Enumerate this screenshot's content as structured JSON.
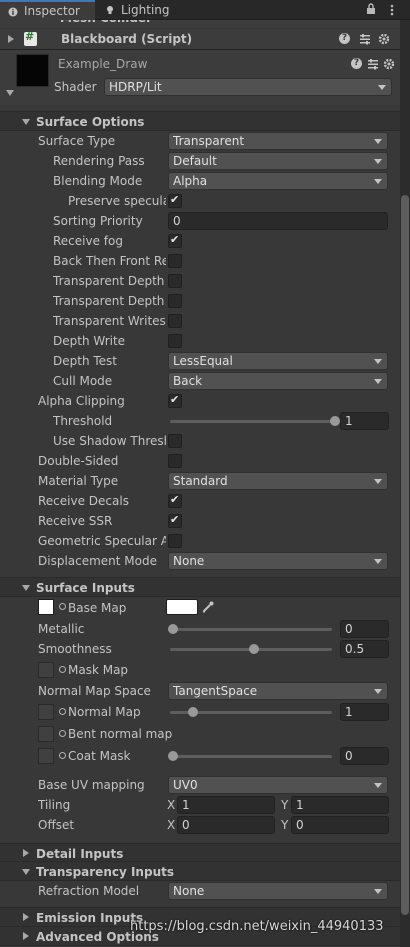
{
  "tabs": [
    {
      "label": "Inspector",
      "icon": "info-icon"
    },
    {
      "label": "Lighting",
      "icon": "bulb-icon"
    }
  ],
  "components": {
    "mesh_collider": "Mesh Collider",
    "blackboard": "Blackboard (Script)"
  },
  "material": {
    "name": "Example_Draw",
    "shader_label": "Shader",
    "shader_value": "HDRP/Lit"
  },
  "surface_options": {
    "title": "Surface Options",
    "surface_type": {
      "label": "Surface Type",
      "value": "Transparent"
    },
    "rendering_pass": {
      "label": "Rendering Pass",
      "value": "Default"
    },
    "blending_mode": {
      "label": "Blending Mode",
      "value": "Alpha"
    },
    "preserve_specular": {
      "label": "Preserve specula",
      "checked": true
    },
    "sorting_priority": {
      "label": "Sorting Priority",
      "value": "0"
    },
    "receive_fog": {
      "label": "Receive fog",
      "checked": true
    },
    "back_then_front": {
      "label": "Back Then Front Ren",
      "checked": false
    },
    "transparent_depth_pre": {
      "label": "Transparent Depth P",
      "checked": false
    },
    "transparent_depth_post": {
      "label": "Transparent Depth P",
      "checked": false
    },
    "transparent_writes_motion": {
      "label": "Transparent Writes M",
      "checked": false
    },
    "depth_write": {
      "label": "Depth Write",
      "checked": false
    },
    "depth_test": {
      "label": "Depth Test",
      "value": "LessEqual"
    },
    "cull_mode": {
      "label": "Cull Mode",
      "value": "Back"
    },
    "alpha_clipping": {
      "label": "Alpha Clipping",
      "checked": true
    },
    "threshold": {
      "label": "Threshold",
      "value": "1",
      "fraction": 1.0
    },
    "use_shadow_threshold": {
      "label": "Use Shadow Thresh",
      "checked": false
    },
    "double_sided": {
      "label": "Double-Sided",
      "checked": false
    },
    "material_type": {
      "label": "Material Type",
      "value": "Standard"
    },
    "receive_decals": {
      "label": "Receive Decals",
      "checked": true
    },
    "receive_ssr": {
      "label": "Receive SSR",
      "checked": true
    },
    "geometric_specular_aa": {
      "label": "Geometric Specular AA",
      "checked": false
    },
    "displacement_mode": {
      "label": "Displacement Mode",
      "value": "None"
    }
  },
  "surface_inputs": {
    "title": "Surface Inputs",
    "base_map": {
      "label": "Base Map"
    },
    "metallic": {
      "label": "Metallic",
      "value": "0",
      "fraction": 0.0
    },
    "smoothness": {
      "label": "Smoothness",
      "value": "0.5",
      "fraction": 0.5
    },
    "mask_map": {
      "label": "Mask Map"
    },
    "normal_map_space": {
      "label": "Normal Map Space",
      "value": "TangentSpace"
    },
    "normal_map": {
      "label": "Normal Map",
      "value": "1",
      "fraction": 0.125
    },
    "bent_normal_map": {
      "label": "Bent normal map"
    },
    "coat_mask": {
      "label": "Coat Mask",
      "value": "0",
      "fraction": 0.0
    },
    "base_uv_mapping": {
      "label": "Base UV mapping",
      "value": "UV0"
    },
    "tiling": {
      "label": "Tiling",
      "x_label": "X",
      "x": "1",
      "y_label": "Y",
      "y": "1"
    },
    "offset": {
      "label": "Offset",
      "x_label": "X",
      "x": "0",
      "y_label": "Y",
      "y": "0"
    }
  },
  "detail_inputs": {
    "title": "Detail Inputs"
  },
  "transparency_inputs": {
    "title": "Transparency Inputs",
    "refraction_model": {
      "label": "Refraction Model",
      "value": "None"
    }
  },
  "emission_inputs": {
    "title": "Emission Inputs"
  },
  "advanced_options": {
    "title": "Advanced Options"
  },
  "watermark": "https://blog.csdn.net/weixin_44940133"
}
